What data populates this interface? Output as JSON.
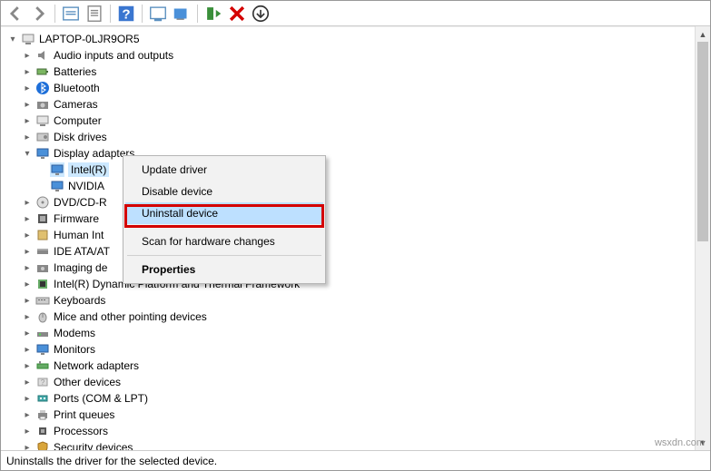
{
  "toolbar": {
    "back": "←",
    "forward": "→",
    "show_hidden": "",
    "properties": "",
    "help": "?",
    "update": "",
    "monitor": "",
    "enable": "",
    "uninstall": "✖",
    "scan": "⬇"
  },
  "root": {
    "name": "LAPTOP-0LJR9OR5"
  },
  "categories": [
    {
      "label": "Audio inputs and outputs",
      "icon": "audio"
    },
    {
      "label": "Batteries",
      "icon": "battery"
    },
    {
      "label": "Bluetooth",
      "icon": "bluetooth"
    },
    {
      "label": "Cameras",
      "icon": "camera"
    },
    {
      "label": "Computer",
      "icon": "computer"
    },
    {
      "label": "Disk drives",
      "icon": "disk"
    },
    {
      "label": "Display adapters",
      "icon": "display",
      "expanded": true,
      "children": [
        {
          "label": "Intel(R)",
          "icon": "display",
          "selected": true
        },
        {
          "label": "NVIDIA",
          "icon": "display"
        }
      ]
    },
    {
      "label": "DVD/CD-R",
      "icon": "dvd"
    },
    {
      "label": "Firmware",
      "icon": "firmware"
    },
    {
      "label": "Human Int",
      "icon": "hid"
    },
    {
      "label": "IDE ATA/AT",
      "icon": "ide"
    },
    {
      "label": "Imaging de",
      "icon": "imaging"
    },
    {
      "label": "Intel(R) Dynamic Platform and Thermal Framework",
      "icon": "thermal"
    },
    {
      "label": "Keyboards",
      "icon": "keyboard"
    },
    {
      "label": "Mice and other pointing devices",
      "icon": "mouse"
    },
    {
      "label": "Modems",
      "icon": "modem"
    },
    {
      "label": "Monitors",
      "icon": "monitor"
    },
    {
      "label": "Network adapters",
      "icon": "network"
    },
    {
      "label": "Other devices",
      "icon": "other"
    },
    {
      "label": "Ports (COM & LPT)",
      "icon": "port"
    },
    {
      "label": "Print queues",
      "icon": "printer"
    },
    {
      "label": "Processors",
      "icon": "cpu"
    },
    {
      "label": "Security devices",
      "icon": "security"
    }
  ],
  "contextmenu": {
    "update": "Update driver",
    "disable": "Disable device",
    "uninstall": "Uninstall device",
    "scan": "Scan for hardware changes",
    "properties": "Properties"
  },
  "statusbar": "Uninstalls the driver for the selected device.",
  "watermark": "wsxdn.com"
}
